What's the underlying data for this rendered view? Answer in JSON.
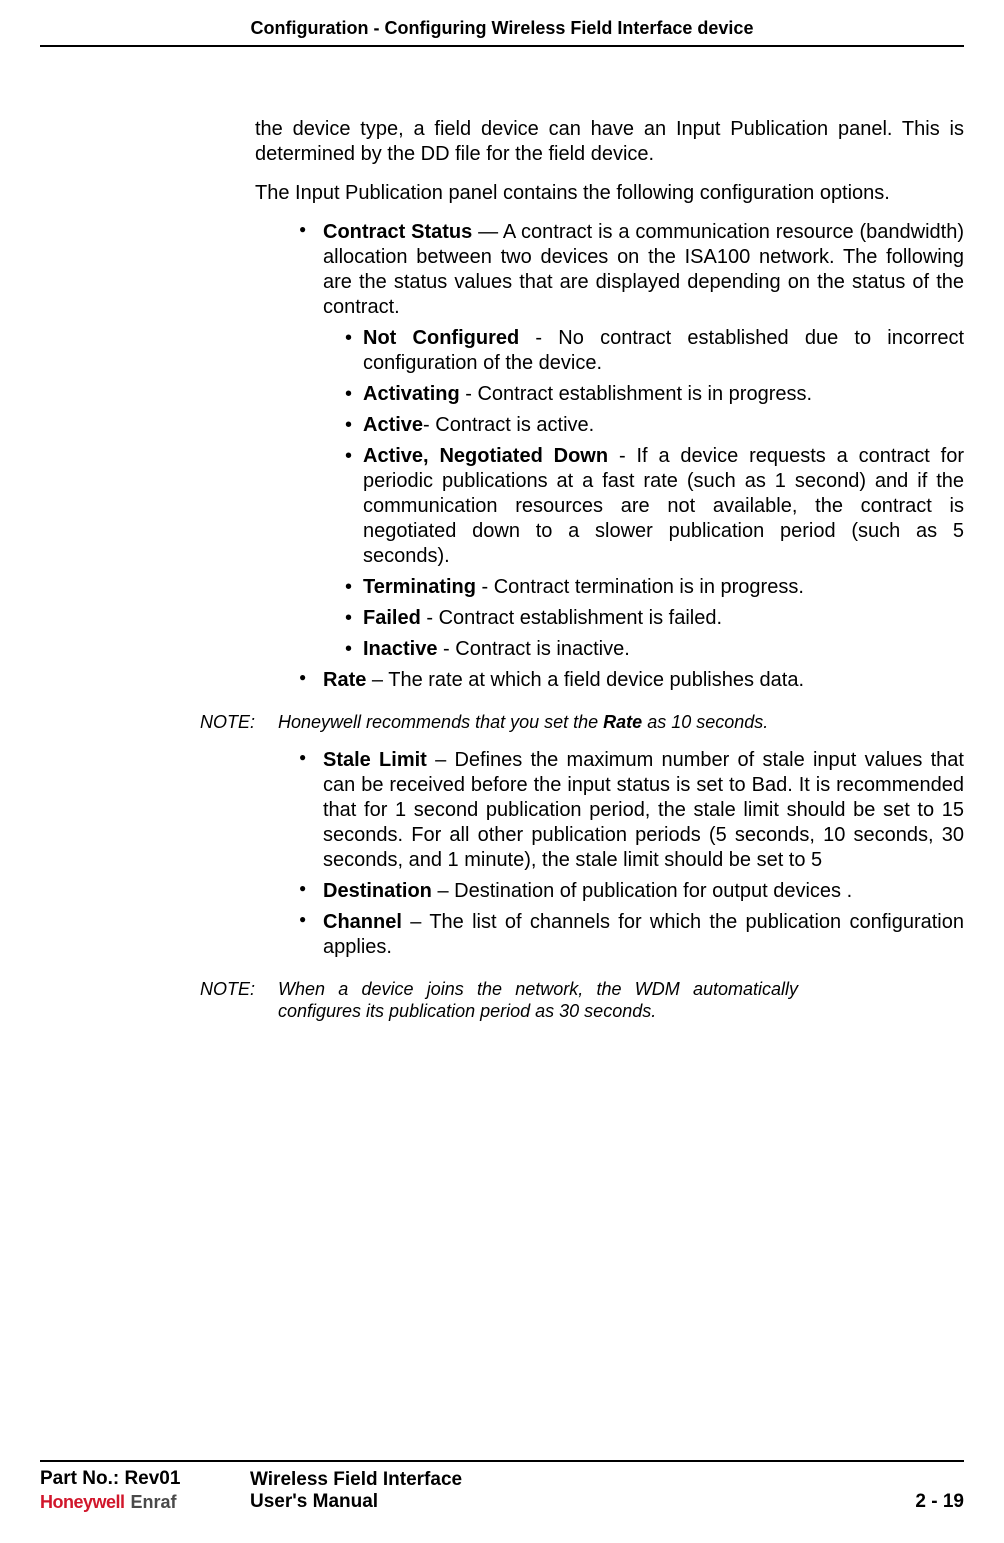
{
  "header": {
    "running_title": "Configuration - Configuring Wireless Field Interface device"
  },
  "body": {
    "intro1": "the device type, a field device can have an Input Publication panel. This is determined by the DD file for the field device.",
    "intro2": "The Input Publication panel contains the following configuration options.",
    "contract_status": {
      "label": "Contract Status",
      "desc": " — A contract is a communication resource (bandwidth) allocation between two devices on the ISA100 network. The following are the status values that are displayed depending on the status of the contract.",
      "items": {
        "not_configured": {
          "label": "Not Configured",
          "desc": " - No contract established due to incorrect configuration of the device."
        },
        "activating": {
          "label": "Activating",
          "desc": " - Contract establishment is in progress."
        },
        "active": {
          "label": "Active",
          "desc": "- Contract is active."
        },
        "active_neg": {
          "label": "Active, Negotiated Down",
          "desc": " - If a device requests a contract for periodic publications at a fast rate (such as 1 second) and if the communication resources are not available, the contract is negotiated down to a slower publication period (such as 5 seconds)."
        },
        "terminating": {
          "label": "Terminating",
          "desc": " - Contract termination is in progress."
        },
        "failed": {
          "label": "Failed",
          "desc": " - Contract establishment is failed."
        },
        "inactive": {
          "label": "Inactive",
          "desc": " - Contract is inactive."
        }
      }
    },
    "rate": {
      "label": "Rate",
      "desc": " – The rate at which a field device publishes data."
    },
    "stale_limit": {
      "label": "Stale Limit",
      "desc": " – Defines the maximum number of stale input values that can be received before the input status is set to Bad. It is recom­mended that for 1 second publication period, the stale limit should be set to 15 seconds. For all other publication periods (5 seconds, 10 seconds, 30 seconds, and 1 minute), the stale limit should be set to 5"
    },
    "destination": {
      "label": "Destination",
      "desc": " – Destination of publication for output devices ."
    },
    "channel": {
      "label": "Channel",
      "desc": " – The list of channels for which the publication configuration applies."
    },
    "note1": {
      "label": "NOTE:",
      "pre": "Honeywell recommends that you set the ",
      "bold": "Rate",
      "post": " as 10 seconds."
    },
    "note2": {
      "label": "NOTE:",
      "text": "When a device joins the network, the WDM automatically configures its publication period as 30 seconds."
    }
  },
  "footer": {
    "part_no": "Part No.: Rev01",
    "logo_hw": "Honeywell",
    "logo_enraf": "Enraf",
    "center1": "Wireless Field Interface",
    "center2": "User's Manual",
    "page": "2 - 19"
  }
}
